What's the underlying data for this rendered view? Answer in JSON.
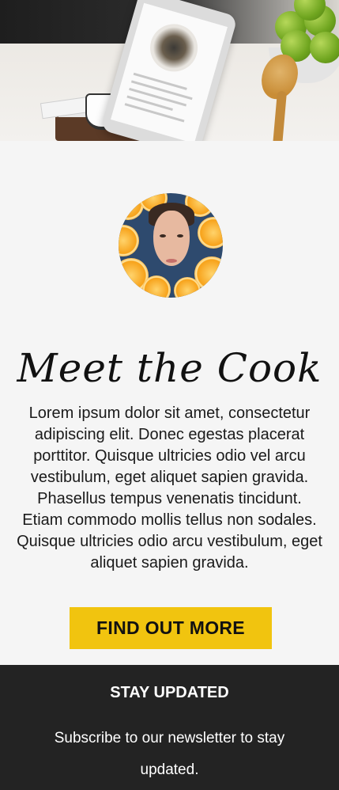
{
  "about": {
    "title": "Meet the Cook",
    "bio": "Lorem ipsum dolor sit amet, consectetur adipiscing elit. Donec egestas placerat porttitor. Quisque ultricies odio vel arcu vestibulum, eget aliquet sapien gravida. Phasellus tempus venenatis tincidunt. Etiam commodo mollis tellus non sodales. Quisque ultricies odio arcu vestibulum, eget aliquet sapien gravida.",
    "cta_label": "FIND OUT MORE",
    "cta_color": "#f1c40f"
  },
  "footer": {
    "heading": "STAY UPDATED",
    "text": "Subscribe to our newsletter to stay updated.",
    "background": "#232323"
  }
}
